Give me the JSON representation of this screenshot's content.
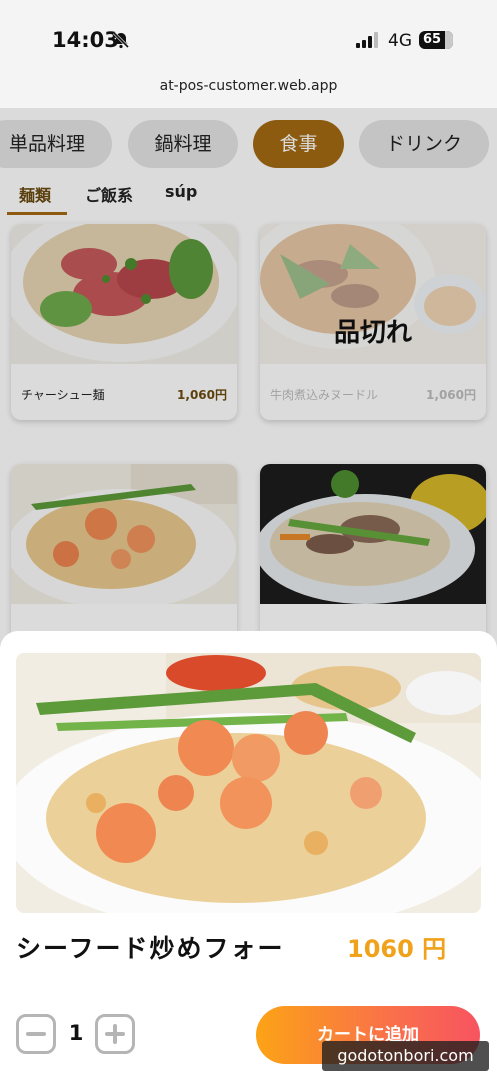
{
  "status_bar": {
    "time": "14:03",
    "network": "4G",
    "battery": "65"
  },
  "browser": {
    "url": "at-pos-customer.web.app"
  },
  "categories": [
    {
      "label": "単品料理",
      "active": false
    },
    {
      "label": "鍋料理",
      "active": false
    },
    {
      "label": "食事",
      "active": true
    },
    {
      "label": "ドリンク",
      "active": false
    }
  ],
  "sub_tabs": [
    {
      "label": "麺類",
      "active": true
    },
    {
      "label": "ご飯系",
      "active": false
    },
    {
      "label": "súp",
      "active": false
    }
  ],
  "menu_items": [
    {
      "name": "チャーシュー麺",
      "price": "1,060円",
      "sold_out": false
    },
    {
      "name": "牛肉煮込みヌードル",
      "price": "1,060円",
      "sold_out": true,
      "sold_out_label": "品切れ"
    },
    {
      "name": "",
      "price": "",
      "sold_out": false
    },
    {
      "name": "",
      "price": "",
      "sold_out": false
    }
  ],
  "detail_sheet": {
    "name": "シーフード炒めフォー",
    "price": "1060 円",
    "quantity": "1",
    "add_to_cart_label": "カートに追加"
  },
  "watermark": "godotonbori.com",
  "colors": {
    "accent_brown": "#a36a12",
    "price_orange": "#f0a21b",
    "cart_gradient_start": "#fca316",
    "cart_gradient_end": "#f85460"
  }
}
